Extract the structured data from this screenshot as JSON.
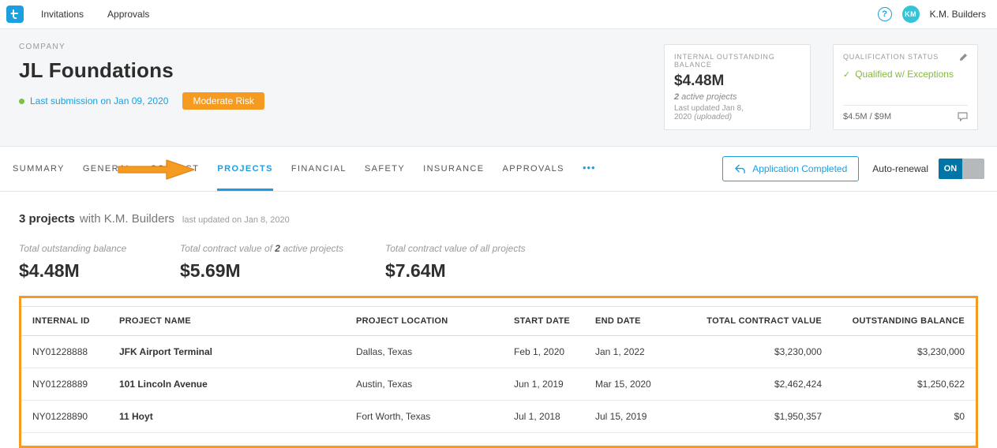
{
  "colors": {
    "accent_blue": "#1b9fe0",
    "annotation_orange": "#f59b22",
    "status_green": "#83b93d",
    "toggle_on_blue": "#0076a8",
    "avatar_teal": "#35c4d7"
  },
  "icons": {
    "help": "?",
    "check": "✓",
    "more": "•••"
  },
  "topbar": {
    "nav": [
      {
        "label": "Invitations"
      },
      {
        "label": "Approvals"
      }
    ],
    "user": {
      "initials": "KM",
      "name": "K.M. Builders"
    }
  },
  "company": {
    "section_label": "COMPANY",
    "name": "JL Foundations",
    "last_submission": "Last submission on Jan 09, 2020",
    "risk_badge": "Moderate Risk"
  },
  "balance_card": {
    "label": "INTERNAL OUTSTANDING BALANCE",
    "amount": "$4.48M",
    "active_count": "2",
    "active_suffix": " active projects",
    "updated": "Last updated Jan 8, 2020",
    "updated_note": "(uploaded)"
  },
  "qualification_card": {
    "label": "QUALIFICATION STATUS",
    "status": "Qualified w/ Exceptions",
    "limits": "$4.5M / $9M"
  },
  "tabbar": {
    "tabs": [
      "SUMMARY",
      "GENERAL",
      "CONTACT",
      "PROJECTS",
      "FINANCIAL",
      "SAFETY",
      "INSURANCE",
      "APPROVALS"
    ],
    "active_tab": "PROJECTS",
    "application_button": "Application Completed",
    "auto_renewal_label": "Auto-renewal",
    "toggle_on": "ON"
  },
  "projects": {
    "count": "3 projects",
    "with": "with K.M. Builders",
    "last_updated": "last updated on Jan 8, 2020",
    "stats": [
      {
        "label": "Total outstanding balance",
        "value": "$4.48M"
      },
      {
        "label_prefix": "Total contract value of ",
        "label_bold": "2",
        "label_suffix": " active projects",
        "value": "$5.69M"
      },
      {
        "label": "Total contract value of all projects",
        "value": "$7.64M"
      }
    ],
    "table": {
      "headers": [
        "INTERNAL ID",
        "PROJECT NAME",
        "PROJECT LOCATION",
        "START DATE",
        "END DATE",
        "TOTAL CONTRACT VALUE",
        "OUTSTANDING BALANCE"
      ],
      "rows": [
        [
          "NY01228888",
          "JFK Airport Terminal",
          "Dallas, Texas",
          "Feb 1, 2020",
          "Jan 1, 2022",
          "$3,230,000",
          "$3,230,000"
        ],
        [
          "NY01228889",
          "101 Lincoln Avenue",
          "Austin, Texas",
          "Jun 1, 2019",
          "Mar 15, 2020",
          "$2,462,424",
          "$1,250,622"
        ],
        [
          "NY01228890",
          "11 Hoyt",
          "Fort Worth, Texas",
          "Jul 1, 2018",
          "Jul 15, 2019",
          "$1,950,357",
          "$0"
        ]
      ]
    }
  }
}
